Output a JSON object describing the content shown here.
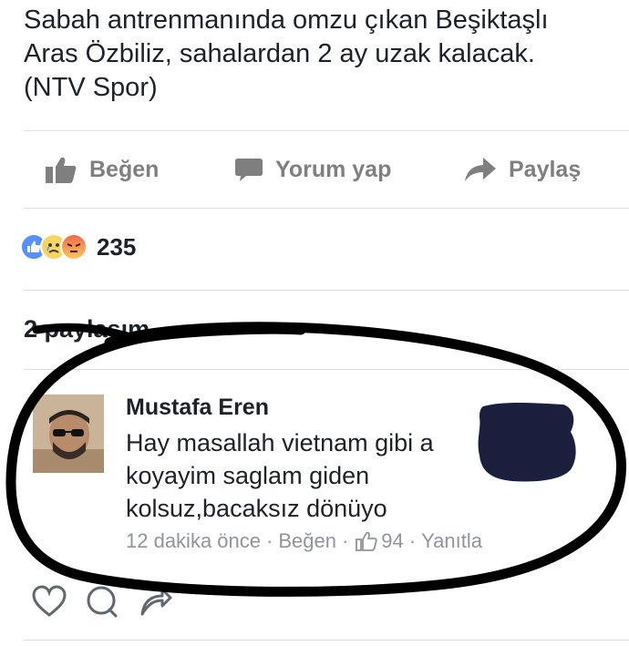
{
  "post": {
    "text_lines": [
      "Sabah antrenmanında omzu çıkan Beşiktaşlı",
      "Aras Özbiliz, sahalardan 2 ay uzak kalacak.",
      "(NTV Spor)"
    ]
  },
  "actions": {
    "like_label": "Beğen",
    "comment_label": "Yorum yap",
    "share_label": "Paylaş"
  },
  "reactions": {
    "types": [
      "like",
      "sad",
      "angry"
    ],
    "count": "235"
  },
  "shares": {
    "label": "2 paylaşım"
  },
  "comment": {
    "author": "Mustafa Eren",
    "text_lines": [
      "Hay masallah vietnam gibi a",
      "koyayim saglam giden",
      "kolsuz,bacaksız dönüyo"
    ],
    "time": "12 dakika önce",
    "like_label": "Beğen",
    "like_count": "94",
    "reply_label": "Yanıtla"
  },
  "bottom_icons": [
    "heart-icon",
    "comment-bubble-icon",
    "share-arrow-icon"
  ],
  "colors": {
    "text": "#1d2129",
    "muted": "#7f7f7f",
    "meta": "#90949c",
    "like_blue": "#5890ff",
    "redaction": "#1a1f3d"
  }
}
